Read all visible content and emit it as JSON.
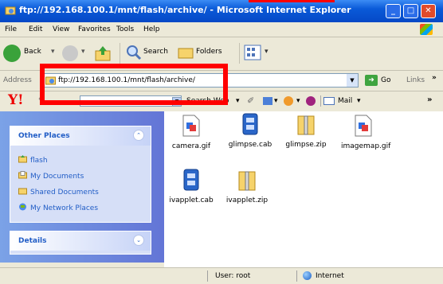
{
  "window": {
    "title": "ftp://192.168.100.1/mnt/flash/archive/ - Microsoft Internet Explorer",
    "min_glyph": "_",
    "max_glyph": "□",
    "close_glyph": "✕"
  },
  "menu": [
    "File",
    "Edit",
    "View",
    "Favorites",
    "Tools",
    "Help"
  ],
  "toolbar": {
    "back": "Back",
    "search": "Search",
    "folders": "Folders"
  },
  "address": {
    "label": "Address",
    "value": "ftp://192.168.100.1/mnt/flash/archive/",
    "go": "Go",
    "links": "Links"
  },
  "yahoo": {
    "logo": "Y!",
    "search_label": "Search Web",
    "mail": "Mail"
  },
  "sidebar": {
    "other_places": {
      "title": "Other Places",
      "items": [
        {
          "label": "flash",
          "icon": "folder-up-icon"
        },
        {
          "label": "My Documents",
          "icon": "documents-folder-icon"
        },
        {
          "label": "Shared Documents",
          "icon": "shared-folder-icon"
        },
        {
          "label": "My Network Places",
          "icon": "network-places-icon"
        }
      ]
    },
    "details": {
      "title": "Details"
    }
  },
  "files": [
    {
      "name": "camera.gif",
      "type": "image"
    },
    {
      "name": "glimpse.cab",
      "type": "cabinet"
    },
    {
      "name": "glimpse.zip",
      "type": "zip"
    },
    {
      "name": "imagemap.gif",
      "type": "image"
    },
    {
      "name": "ivapplet.cab",
      "type": "cabinet"
    },
    {
      "name": "ivapplet.zip",
      "type": "zip"
    }
  ],
  "status": {
    "user": "User: root",
    "zone": "Internet"
  },
  "colors": {
    "titlebar": "#0a5ad8",
    "highlight": "#ff0000",
    "link": "#215dc6",
    "taskpane": "#6375d6"
  }
}
